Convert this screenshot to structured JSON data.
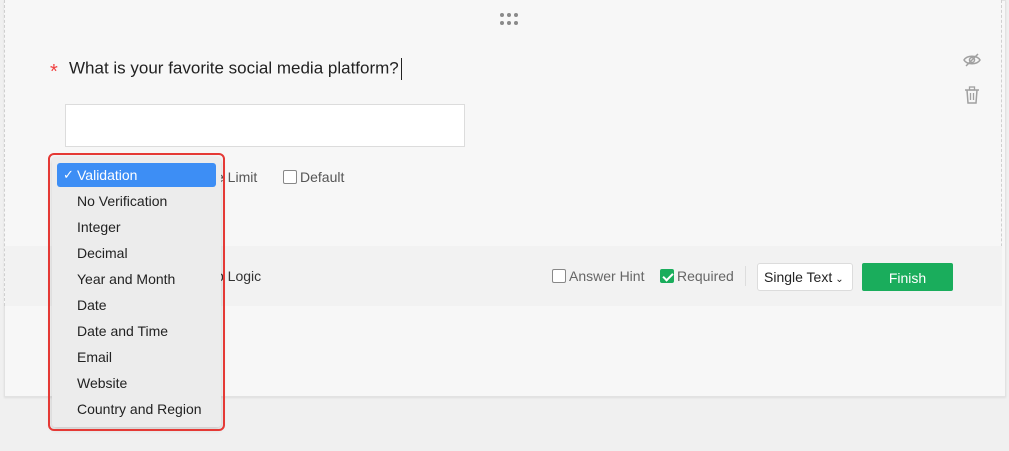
{
  "question": {
    "required_star": "*",
    "title": "What is your favorite social media platform?"
  },
  "options": {
    "limit_label": "e Limit",
    "default_label": "Default"
  },
  "footer": {
    "logic_label": "p Logic",
    "answer_hint_label": "Answer Hint",
    "required_label": "Required",
    "type_select_value": "Single Text",
    "finish_label": "Finish"
  },
  "validation_menu": {
    "items": [
      "Validation",
      "No Verification",
      "Integer",
      "Decimal",
      "Year and Month",
      "Date",
      "Date and Time",
      "Email",
      "Website",
      "Country and Region"
    ],
    "selected": "Validation"
  },
  "icons": {
    "drag": "drag-handle-icon",
    "hide": "eye-slash-icon",
    "delete": "trash-icon",
    "check": "checkmark-icon"
  },
  "colors": {
    "accent_green": "#1aad5c",
    "selected_blue": "#3d8ef5",
    "highlight_red": "#e53935",
    "required_red": "#f04040"
  }
}
